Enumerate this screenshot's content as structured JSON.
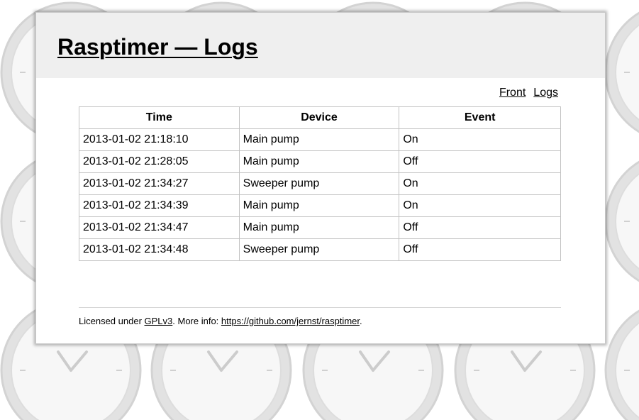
{
  "page": {
    "background": "#ffffff",
    "header_background": "#efefef"
  },
  "header": {
    "title": "Rasptimer — Logs"
  },
  "nav": {
    "front_label": "Front",
    "logs_label": "Logs"
  },
  "table": {
    "columns": [
      "Time",
      "Device",
      "Event"
    ],
    "rows": [
      [
        "2013-01-02 21:18:10",
        "Main pump",
        "On"
      ],
      [
        "2013-01-02 21:28:05",
        "Main pump",
        "Off"
      ],
      [
        "2013-01-02 21:34:27",
        "Sweeper pump",
        "On"
      ],
      [
        "2013-01-02 21:34:39",
        "Main pump",
        "On"
      ],
      [
        "2013-01-02 21:34:47",
        "Main pump",
        "Off"
      ],
      [
        "2013-01-02 21:34:48",
        "Sweeper pump",
        "Off"
      ]
    ]
  },
  "footer": {
    "prefix": "Licensed under ",
    "license_link": "GPLv3",
    "middle": ". More info: ",
    "info_link": "https://github.com/jernst/rasptimer",
    "suffix": "."
  }
}
